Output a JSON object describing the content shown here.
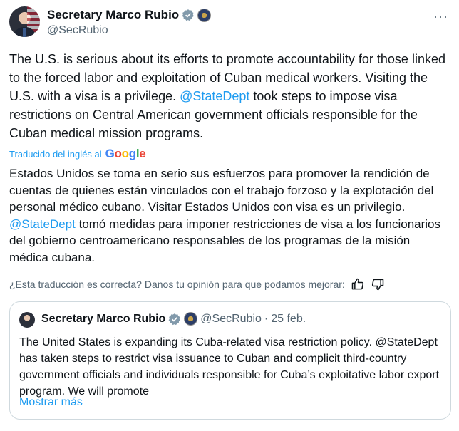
{
  "author": {
    "name": "Secretary Marco Rubio",
    "handle": "@SecRubio"
  },
  "menu": {
    "more_label": "···"
  },
  "tweet": {
    "part1": "The U.S. is serious about its efforts to promote accountability for those linked to the forced labor and exploitation of Cuban medical workers. Visiting the U.S. with a visa is a privilege. ",
    "mention": "@StateDept",
    "part2": " took steps to impose visa restrictions on Central American government officials responsible for the Cuban medical mission programs."
  },
  "translation_label": "Traducido del inglés al",
  "google_logo_text": "Google",
  "translation": {
    "part1": "Estados Unidos se toma en serio sus esfuerzos para promover la rendición de cuentas de quienes están vinculados con el trabajo forzoso y la explotación del personal médico cubano. Visitar Estados Unidos con visa es un privilegio. ",
    "mention": "@StateDept",
    "part2": " tomó medidas para imponer restricciones de visa a los funcionarios del gobierno centroamericano responsables de los programas de la misión médica cubana."
  },
  "feedback": {
    "prompt": "¿Esta traducción es correcta? Danos tu opinión para que podamos mejorar:",
    "thumbs_up_icon": "thumbs-up-icon",
    "thumbs_down_icon": "thumbs-down-icon"
  },
  "quoted": {
    "name": "Secretary Marco Rubio",
    "handle": "@SecRubio",
    "separator": "·",
    "date": "25 feb.",
    "text": "The United States is expanding its Cuba-related visa restriction policy. @StateDept has taken steps to restrict visa issuance to Cuban and complicit third-country government officials and individuals responsible for Cuba’s exploitative labor export program. We will promote",
    "show_more": "Mostrar más"
  },
  "colors": {
    "link": "#1d9bf0",
    "secondary_text": "#536471",
    "border": "#cfd9de"
  }
}
